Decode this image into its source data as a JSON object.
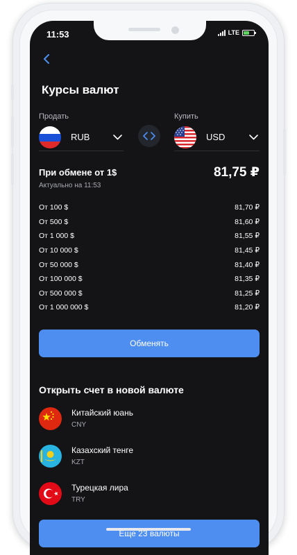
{
  "status": {
    "time": "11:53",
    "network": "LTE",
    "battery_level": 0.6
  },
  "header": {
    "title": "Курсы валют"
  },
  "sell": {
    "label": "Продать",
    "currency": "RUB"
  },
  "buy": {
    "label": "Купить",
    "currency": "USD"
  },
  "rate": {
    "label": "При обмене от 1$",
    "value": "81,75 ₽",
    "updated": "Актуально на 11:53"
  },
  "tiers": [
    {
      "from": "От 100 $",
      "rate": "81,70 ₽"
    },
    {
      "from": "От 500 $",
      "rate": "81,60 ₽"
    },
    {
      "from": "От 1 000 $",
      "rate": "81,55 ₽"
    },
    {
      "from": "От 10 000 $",
      "rate": "81,45 ₽"
    },
    {
      "from": "От 50 000 $",
      "rate": "81,40 ₽"
    },
    {
      "from": "От 100 000 $",
      "rate": "81,35 ₽"
    },
    {
      "from": "От 500 000 $",
      "rate": "81,25 ₽"
    },
    {
      "from": "От 1 000 000 $",
      "rate": "81,20 ₽"
    }
  ],
  "exchange_button": "Обменять",
  "accounts": {
    "title": "Открыть счет в новой валюте",
    "items": [
      {
        "name": "Китайский юань",
        "code": "CNY"
      },
      {
        "name": "Казахский тенге",
        "code": "KZT"
      },
      {
        "name": "Турецкая лира",
        "code": "TRY"
      }
    ]
  },
  "more_button": "Еще 23 валюты",
  "colors": {
    "background": "#141417",
    "accent": "#4d8ef0",
    "text": "#ffffff",
    "muted": "#a8aab2"
  }
}
